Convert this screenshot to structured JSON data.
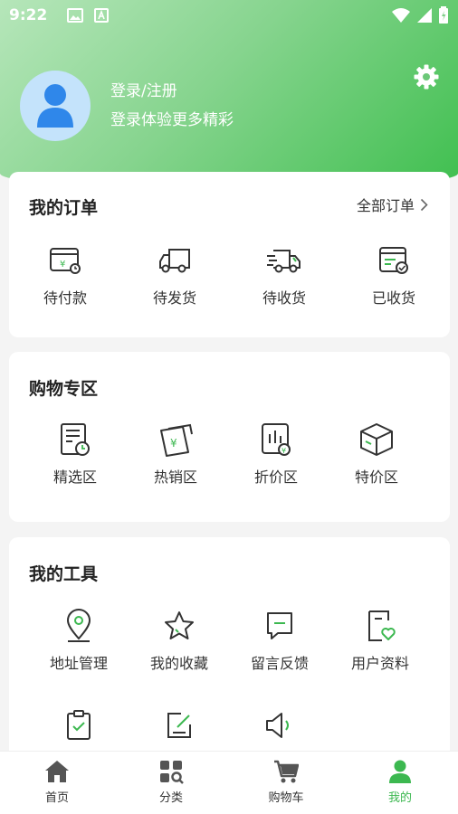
{
  "status_bar": {
    "time": "9:22"
  },
  "profile": {
    "title": "登录/注册",
    "subtitle": "登录体验更多精彩"
  },
  "orders": {
    "title": "我的订单",
    "all_orders_label": "全部订单",
    "items": [
      {
        "label": "待付款",
        "icon": "wallet-icon"
      },
      {
        "label": "待发货",
        "icon": "truck-icon"
      },
      {
        "label": "待收货",
        "icon": "delivery-truck-icon"
      },
      {
        "label": "已收货",
        "icon": "received-check-icon"
      }
    ]
  },
  "shopping": {
    "title": "购物专区",
    "items": [
      {
        "label": "精选区",
        "icon": "selection-list-icon"
      },
      {
        "label": "热销区",
        "icon": "hot-sale-icon"
      },
      {
        "label": "折价区",
        "icon": "discount-icon"
      },
      {
        "label": "特价区",
        "icon": "special-box-icon"
      }
    ]
  },
  "tools": {
    "title": "我的工具",
    "items": [
      {
        "label": "地址管理",
        "icon": "location-pin-icon"
      },
      {
        "label": "我的收藏",
        "icon": "star-icon"
      },
      {
        "label": "留言反馈",
        "icon": "message-icon"
      },
      {
        "label": "用户资料",
        "icon": "user-profile-icon"
      },
      {
        "label": "",
        "icon": "clipboard-check-icon"
      },
      {
        "label": "",
        "icon": "edit-note-icon"
      },
      {
        "label": "",
        "icon": "speaker-icon"
      }
    ]
  },
  "tabbar": {
    "items": [
      {
        "label": "首页",
        "icon": "home-icon"
      },
      {
        "label": "分类",
        "icon": "category-icon"
      },
      {
        "label": "购物车",
        "icon": "cart-icon"
      },
      {
        "label": "我的",
        "icon": "person-icon"
      }
    ]
  },
  "colors": {
    "accent": "#3cb850",
    "icon_dark": "#333333",
    "avatar_bg": "#c4e3fb",
    "avatar_fg": "#2f87ea"
  }
}
